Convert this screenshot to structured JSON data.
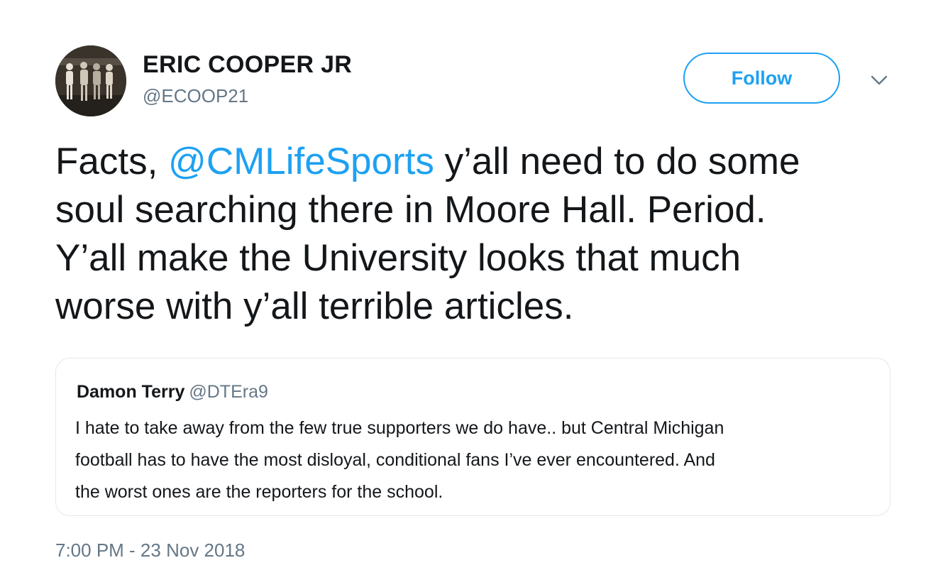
{
  "author": {
    "display_name": "ERIC COOPER JR",
    "handle": "@ECOOP21",
    "avatar_icon": "profile-photo"
  },
  "actions": {
    "follow_label": "Follow",
    "more_icon": "chevron-down-icon"
  },
  "tweet": {
    "line1_prefix": "Facts, ",
    "mention": "@CMLifeSports",
    "line1_suffix": " y’all need to do some",
    "line2": "soul searching there in Moore Hall. Period.",
    "line3": "Y’all make the University looks that much",
    "line4": "worse with y’all terrible articles."
  },
  "quoted_tweet": {
    "display_name": "Damon Terry",
    "handle": "@DTEra9",
    "lines": [
      "I hate to take away from the few true supporters we do have.. but Central Michigan",
      "football has to have the most disloyal, conditional fans I’ve ever encountered. And",
      "the worst ones are the reporters for the school."
    ]
  },
  "timestamp": "7:00 PM - 23 Nov 2018",
  "colors": {
    "accent": "#1da1f2",
    "secondary_text": "#657786",
    "primary_text": "#14171a",
    "card_border": "#e1e8ed"
  }
}
